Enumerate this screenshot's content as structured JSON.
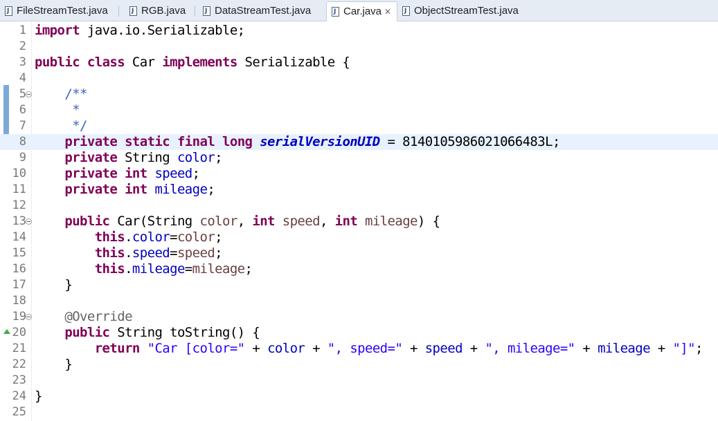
{
  "tabs": [
    {
      "label": "FileStreamTest.java",
      "active": false
    },
    {
      "label": "RGB.java",
      "active": false
    },
    {
      "label": "DataStreamTest.java",
      "active": false
    },
    {
      "label": "Car.java",
      "active": true,
      "close": "✕"
    },
    {
      "label": "ObjectStreamTest.java",
      "active": false
    }
  ],
  "editor": {
    "current_line": 8,
    "lines": [
      {
        "n": "1",
        "tokens": [
          [
            "kw",
            "import"
          ],
          [
            "",
            " java.io.Serializable;"
          ]
        ]
      },
      {
        "n": "2",
        "tokens": []
      },
      {
        "n": "3",
        "tokens": [
          [
            "kw",
            "public"
          ],
          [
            "",
            " "
          ],
          [
            "kw",
            "class"
          ],
          [
            "",
            " Car "
          ],
          [
            "kw",
            "implements"
          ],
          [
            "",
            " Serializable {"
          ]
        ]
      },
      {
        "n": "4",
        "tokens": []
      },
      {
        "n": "5",
        "fold": true,
        "tokens": [
          [
            "",
            "    "
          ],
          [
            "cmt",
            "/**"
          ]
        ]
      },
      {
        "n": "6",
        "tokens": [
          [
            "",
            "     "
          ],
          [
            "cmt",
            "*"
          ]
        ]
      },
      {
        "n": "7",
        "tokens": [
          [
            "",
            "     "
          ],
          [
            "cmt",
            "*/"
          ]
        ]
      },
      {
        "n": "8",
        "tokens": [
          [
            "",
            "    "
          ],
          [
            "kw",
            "private"
          ],
          [
            "",
            " "
          ],
          [
            "kw",
            "static"
          ],
          [
            "",
            " "
          ],
          [
            "kw",
            "final"
          ],
          [
            "",
            " "
          ],
          [
            "kw",
            "long"
          ],
          [
            "",
            " "
          ],
          [
            "sfld",
            "serialVersionUID"
          ],
          [
            "",
            " = 8140105986021066483L;"
          ]
        ]
      },
      {
        "n": "9",
        "tokens": [
          [
            "",
            "    "
          ],
          [
            "kw",
            "private"
          ],
          [
            "",
            " String "
          ],
          [
            "fld",
            "color"
          ],
          [
            "",
            ";"
          ]
        ]
      },
      {
        "n": "10",
        "tokens": [
          [
            "",
            "    "
          ],
          [
            "kw",
            "private"
          ],
          [
            "",
            " "
          ],
          [
            "kw",
            "int"
          ],
          [
            "",
            " "
          ],
          [
            "fld",
            "speed"
          ],
          [
            "",
            ";"
          ]
        ]
      },
      {
        "n": "11",
        "tokens": [
          [
            "",
            "    "
          ],
          [
            "kw",
            "private"
          ],
          [
            "",
            " "
          ],
          [
            "kw",
            "int"
          ],
          [
            "",
            " "
          ],
          [
            "fld",
            "mileage"
          ],
          [
            "",
            ";"
          ]
        ]
      },
      {
        "n": "12",
        "tokens": []
      },
      {
        "n": "13",
        "fold": true,
        "tokens": [
          [
            "",
            "    "
          ],
          [
            "kw",
            "public"
          ],
          [
            "",
            " Car(String "
          ],
          [
            "par",
            "color"
          ],
          [
            "",
            ", "
          ],
          [
            "kw",
            "int"
          ],
          [
            "",
            " "
          ],
          [
            "par",
            "speed"
          ],
          [
            "",
            ", "
          ],
          [
            "kw",
            "int"
          ],
          [
            "",
            " "
          ],
          [
            "par",
            "mileage"
          ],
          [
            "",
            ") {"
          ]
        ]
      },
      {
        "n": "14",
        "tokens": [
          [
            "",
            "        "
          ],
          [
            "kw",
            "this"
          ],
          [
            "",
            "."
          ],
          [
            "fld",
            "color"
          ],
          [
            "",
            "="
          ],
          [
            "par",
            "color"
          ],
          [
            "",
            ";"
          ]
        ]
      },
      {
        "n": "15",
        "tokens": [
          [
            "",
            "        "
          ],
          [
            "kw",
            "this"
          ],
          [
            "",
            "."
          ],
          [
            "fld",
            "speed"
          ],
          [
            "",
            "="
          ],
          [
            "par",
            "speed"
          ],
          [
            "",
            ";"
          ]
        ]
      },
      {
        "n": "16",
        "tokens": [
          [
            "",
            "        "
          ],
          [
            "kw",
            "this"
          ],
          [
            "",
            "."
          ],
          [
            "fld",
            "mileage"
          ],
          [
            "",
            "="
          ],
          [
            "par",
            "mileage"
          ],
          [
            "",
            ";"
          ]
        ]
      },
      {
        "n": "17",
        "tokens": [
          [
            "",
            "    }"
          ]
        ]
      },
      {
        "n": "18",
        "tokens": []
      },
      {
        "n": "19",
        "fold": true,
        "tokens": [
          [
            "",
            "    "
          ],
          [
            "ann",
            "@Override"
          ]
        ]
      },
      {
        "n": "20",
        "override": true,
        "tokens": [
          [
            "",
            "    "
          ],
          [
            "kw",
            "public"
          ],
          [
            "",
            " String toString() {"
          ]
        ]
      },
      {
        "n": "21",
        "tokens": [
          [
            "",
            "        "
          ],
          [
            "kw",
            "return"
          ],
          [
            "",
            " "
          ],
          [
            "str",
            "\"Car [color=\""
          ],
          [
            "",
            " + "
          ],
          [
            "fld",
            "color"
          ],
          [
            "",
            " + "
          ],
          [
            "str",
            "\", speed=\""
          ],
          [
            "",
            " + "
          ],
          [
            "fld",
            "speed"
          ],
          [
            "",
            " + "
          ],
          [
            "str",
            "\", mileage=\""
          ],
          [
            "",
            " + "
          ],
          [
            "fld",
            "mileage"
          ],
          [
            "",
            " + "
          ],
          [
            "str",
            "\"]\""
          ],
          [
            "",
            ";"
          ]
        ]
      },
      {
        "n": "22",
        "tokens": [
          [
            "",
            "    }"
          ]
        ]
      },
      {
        "n": "23",
        "tokens": []
      },
      {
        "n": "24",
        "tokens": [
          [
            "",
            "}"
          ]
        ]
      },
      {
        "n": "25",
        "tokens": []
      }
    ]
  }
}
